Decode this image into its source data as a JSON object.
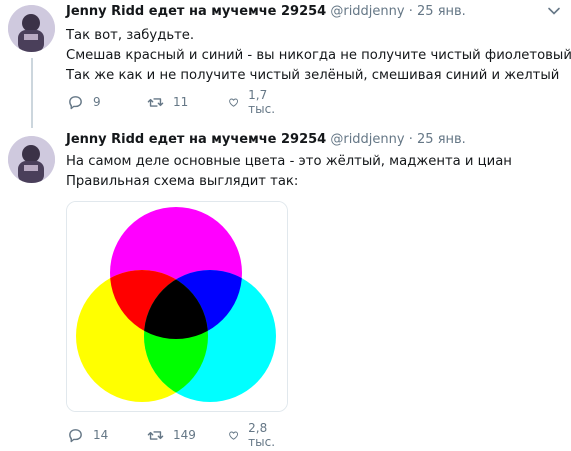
{
  "tweets": [
    {
      "author_name": "Jenny Ridd едет на мучемче 29254",
      "handle": "@riddjenny",
      "separator": "·",
      "date": "25 янв.",
      "lines": [
        "Так вот, забудьте.",
        "Смешав красный и синий - вы никогда не получите чистый фиолетовый",
        "Так же как и не получите чистый зелёный, смешивая синий и желтый"
      ],
      "replies": "9",
      "retweets": "11",
      "likes": "1,7 тыс."
    },
    {
      "author_name": "Jenny Ridd едет на мучемче 29254",
      "handle": "@riddjenny",
      "separator": "·",
      "date": "25 янв.",
      "lines": [
        "На самом деле основные цвета - это жёлтый, маджента и циан",
        "Правильная схема выглядит так:"
      ],
      "replies": "14",
      "retweets": "149",
      "likes": "2,8 тыс."
    }
  ],
  "colors": {
    "name": "#14171a",
    "meta": "#657786",
    "border": "#e1e8ed",
    "thread_line": "#ccd6dd",
    "magenta": "#ff00ff",
    "yellow": "#ffff00",
    "cyan": "#00ffff",
    "red": "#ff0000",
    "green": "#00ff00",
    "blue": "#0000ff",
    "black": "#000000"
  },
  "icons": [
    "avatar",
    "chevron-down-icon",
    "reply-icon",
    "retweet-icon",
    "like-icon"
  ]
}
